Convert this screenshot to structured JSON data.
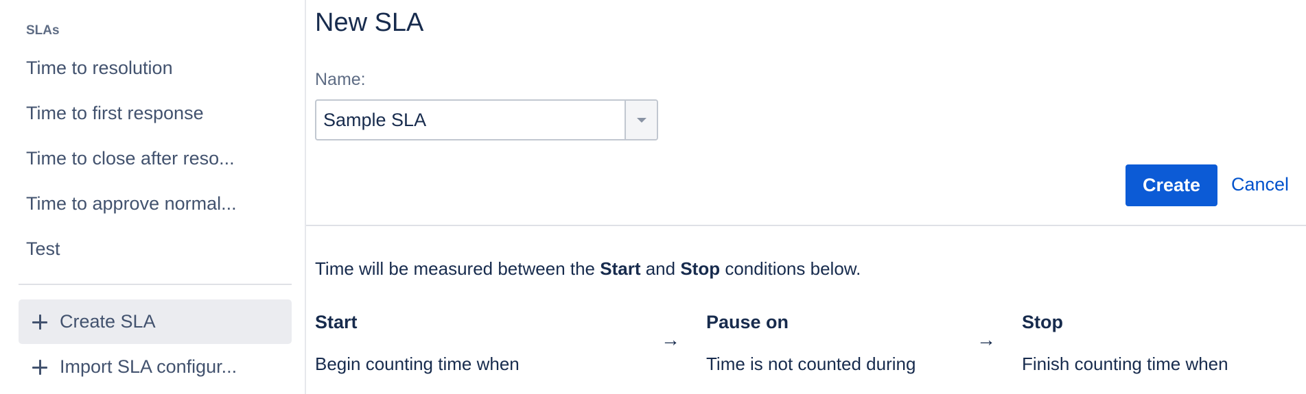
{
  "sidebar": {
    "heading": "SLAs",
    "items": [
      {
        "label": "Time to resolution"
      },
      {
        "label": "Time to first response"
      },
      {
        "label": "Time to close after reso..."
      },
      {
        "label": "Time to approve normal..."
      },
      {
        "label": "Test"
      }
    ],
    "actions": {
      "create": "Create SLA",
      "import": "Import SLA configur..."
    }
  },
  "main": {
    "title": "New SLA",
    "name_label": "Name:",
    "name_value": "Sample SLA",
    "create_label": "Create",
    "cancel_label": "Cancel",
    "intro": {
      "prefix": "Time will be measured between the ",
      "start_word": "Start",
      "middle": " and ",
      "stop_word": "Stop",
      "suffix": " conditions below."
    },
    "columns": {
      "start": {
        "title": "Start",
        "desc": "Begin counting time when"
      },
      "pause": {
        "title": "Pause on",
        "desc": "Time is not counted during"
      },
      "stop": {
        "title": "Stop",
        "desc": "Finish counting time when"
      }
    },
    "arrow_glyph": "→"
  },
  "colors": {
    "primary_button": "#0c5bd6",
    "link": "#0052cc",
    "text": "#172b4d",
    "sidebar_text": "#42526e",
    "active_item_bg": "#ebecf0"
  }
}
